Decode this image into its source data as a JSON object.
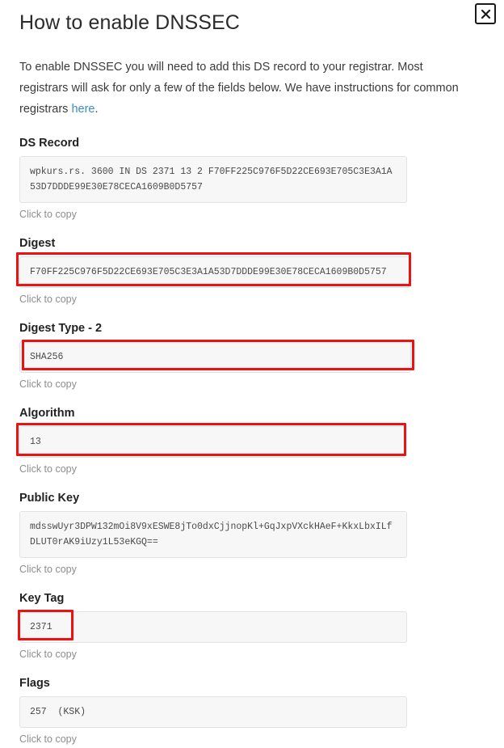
{
  "modal": {
    "title": "How to enable DNSSEC",
    "close_label": "×",
    "close_icon": "close-icon",
    "intro": {
      "part1": "To enable DNSSEC you will need to add this DS record to your registrar. Most registrars will ask for only a few of the fields below. We have instructions for common registrars ",
      "link_text": "here",
      "part2": "."
    },
    "copy_hint": "Click to copy",
    "accent_highlight_color": "#ee1111",
    "link_color": "#3a8ec4",
    "fields": [
      {
        "label": "DS Record",
        "value": "wpkurs.rs. 3600 IN DS 2371 13 2 F70FF225C976F5D22CE693E705C3E3A1A53D7DDDE99E30E78CECA1609B0D5757",
        "hint": "Click to copy",
        "highlighted": false
      },
      {
        "label": "Digest",
        "value": "F70FF225C976F5D22CE693E705C3E3A1A53D7DDDE99E30E78CECA1609B0D5757",
        "hint": "Click to copy",
        "highlighted": true
      },
      {
        "label": "Digest Type - 2",
        "value": "SHA256",
        "hint": "Click to copy",
        "highlighted": true
      },
      {
        "label": "Algorithm",
        "value": "13",
        "hint": "Click to copy",
        "highlighted": true
      },
      {
        "label": "Public Key",
        "value": "mdsswUyr3DPW132mOi8V9xESWE8jTo0dxCjjnopKl+GqJxpVXckHAeF+KkxLbxILfDLUT0rAK9iUzy1L53eKGQ==",
        "hint": "Click to copy",
        "highlighted": false
      },
      {
        "label": "Key Tag",
        "value": "2371",
        "hint": "Click to copy",
        "highlighted": true
      },
      {
        "label": "Flags",
        "value": "257  (KSK)",
        "hint": "Click to copy",
        "highlighted": false
      }
    ]
  }
}
